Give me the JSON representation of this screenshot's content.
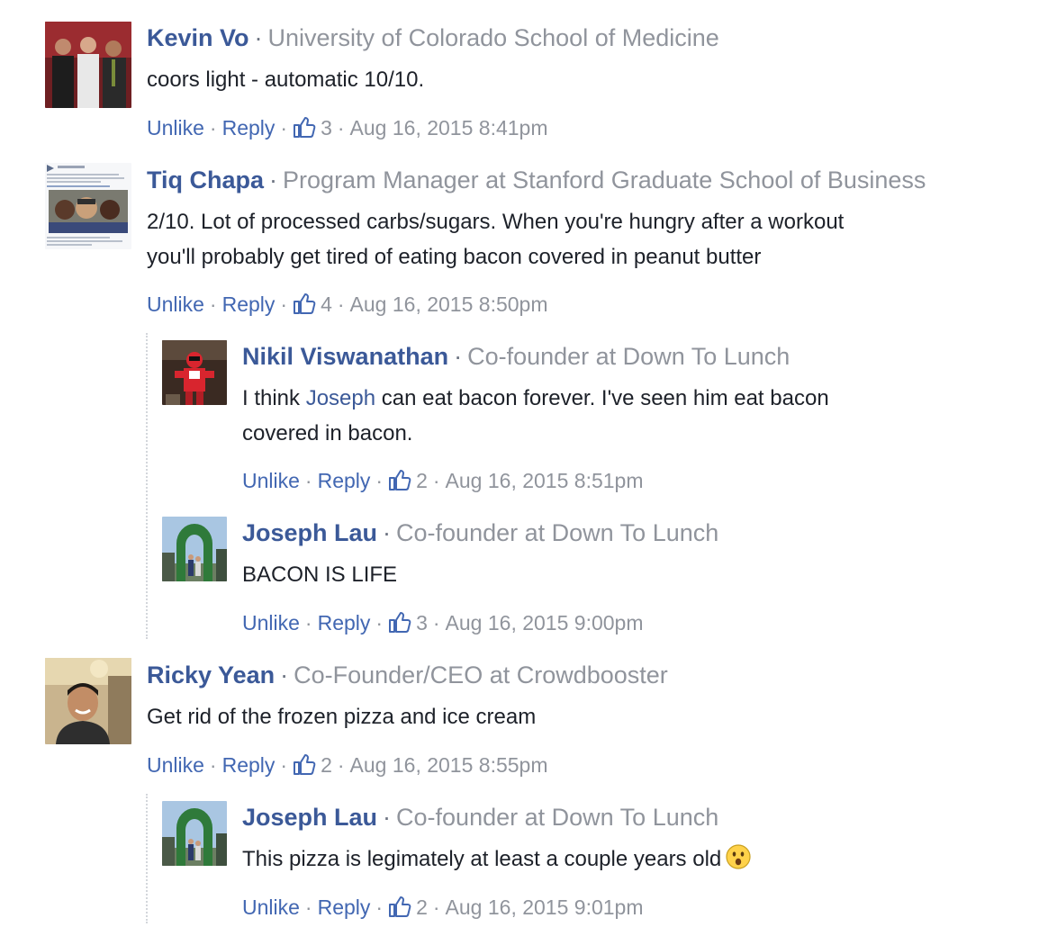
{
  "comments": [
    {
      "name": "Kevin Vo",
      "title": "University of Colorado School of Medicine",
      "lines": [
        "coors light - automatic 10/10."
      ],
      "actions": {
        "unlike": "Unlike",
        "reply": "Reply",
        "likes": "3",
        "time": "Aug 16, 2015 8:41pm"
      }
    },
    {
      "name": "Tiq Chapa",
      "title": "Program Manager at Stanford Graduate School of Business",
      "lines": [
        "2/10. Lot of processed carbs/sugars. When you're hungry after a workout",
        "you'll probably get tired of eating bacon covered in peanut butter"
      ],
      "actions": {
        "unlike": "Unlike",
        "reply": "Reply",
        "likes": "4",
        "time": "Aug 16, 2015 8:50pm"
      },
      "replies": [
        {
          "name": "Nikil Viswanathan",
          "title": "Co-founder at Down To Lunch",
          "line1_pre": "I think ",
          "mention": "Joseph",
          "line1_post": " can eat bacon forever. I've seen him eat bacon",
          "line2": "covered in bacon.",
          "actions": {
            "unlike": "Unlike",
            "reply": "Reply",
            "likes": "2",
            "time": "Aug 16, 2015 8:51pm"
          }
        },
        {
          "name": "Joseph Lau",
          "title": "Co-founder at Down To Lunch",
          "lines": [
            "BACON IS LIFE"
          ],
          "actions": {
            "unlike": "Unlike",
            "reply": "Reply",
            "likes": "3",
            "time": "Aug 16, 2015 9:00pm"
          }
        }
      ]
    },
    {
      "name": "Ricky Yean",
      "title": "Co-Founder/CEO at Crowdbooster",
      "lines": [
        "Get rid of the frozen pizza and ice cream"
      ],
      "actions": {
        "unlike": "Unlike",
        "reply": "Reply",
        "likes": "2",
        "time": "Aug 16, 2015 8:55pm"
      },
      "replies": [
        {
          "name": "Joseph Lau",
          "title": "Co-founder at Down To Lunch",
          "lines": [
            "This pizza is legimately at least a couple years old"
          ],
          "emoji": "surprised-face-emoji",
          "actions": {
            "unlike": "Unlike",
            "reply": "Reply",
            "likes": "2",
            "time": "Aug 16, 2015 9:01pm"
          }
        }
      ]
    }
  ],
  "separator": "·",
  "icons": {
    "like": "thumbs-up-icon"
  },
  "colors": {
    "name": "#3b5998",
    "link": "#4267b2",
    "meta": "#90949c",
    "text": "#1d2129"
  }
}
